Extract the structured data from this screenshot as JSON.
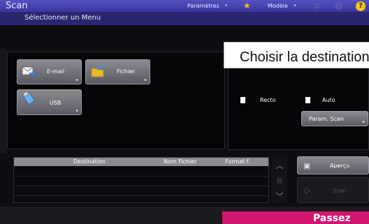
{
  "header": {
    "title": "Scan",
    "subtitle": "Sélectionner un Menu",
    "params_label": "Paramètres",
    "model_label": "Modèle"
  },
  "menu": {
    "email_label": "E-mail",
    "file_label": "Fichier",
    "usb_label": "USB"
  },
  "tooltip": {
    "text": "Choisir la destination"
  },
  "settings": {
    "recto_label": "Recto",
    "auto_label": "Auto",
    "param_scan_label": "Param. Scan"
  },
  "destination_table": {
    "columns": [
      "Destination",
      "Nom Fichier",
      "Format f."
    ]
  },
  "actions": {
    "preview_label": "Aperçu",
    "scan_label": "Scan"
  },
  "banner": {
    "text": "Passez"
  },
  "colors": {
    "header": "#2a2770",
    "accent_yellow": "#f5c512",
    "banner_pink": "#d0166f"
  }
}
